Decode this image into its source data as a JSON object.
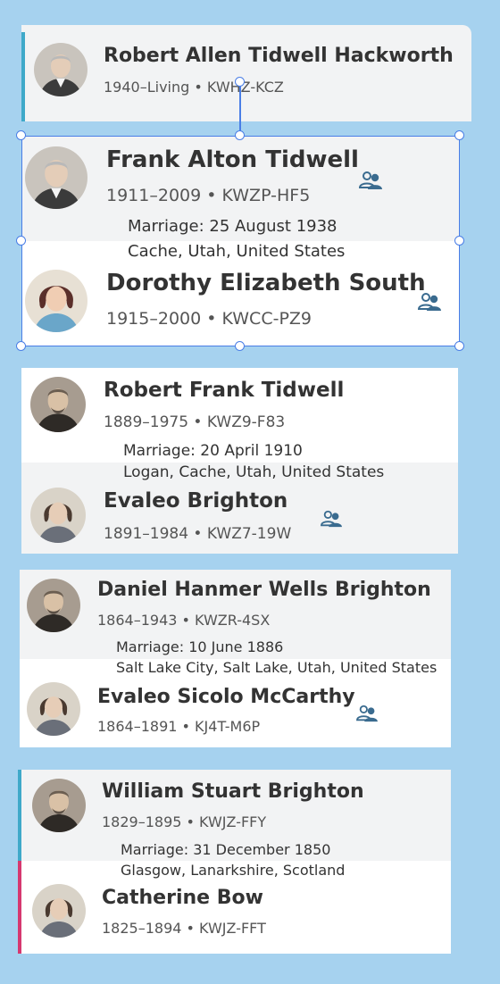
{
  "colors": {
    "background": "#a6d2ef",
    "selection": "#4a7ee6",
    "male_stripe": "#3fa9c9",
    "female_stripe": "#d6386f",
    "relationship_icon": "#3a6b8f"
  },
  "couples": [
    {
      "husband": {
        "name": "Robert Allen Tidwell Hackworth",
        "meta": "1940–Living • KWHZ-KCZ"
      }
    },
    {
      "husband": {
        "name": "Frank Alton Tidwell",
        "meta": "1911–2009 • KWZP-HF5"
      },
      "marriage": {
        "date": "Marriage: 25 August 1938",
        "place": "Cache, Utah, United States"
      },
      "wife": {
        "name": "Dorothy Elizabeth South",
        "meta": "1915–2000 • KWCC-PZ9"
      },
      "selected": true
    },
    {
      "husband": {
        "name": "Robert Frank Tidwell",
        "meta": "1889–1975 • KWZ9-F83"
      },
      "marriage": {
        "date": "Marriage: 20 April 1910",
        "place": "Logan, Cache, Utah, United States"
      },
      "wife": {
        "name": "Evaleo Brighton",
        "meta": "1891–1984 • KWZ7-19W"
      }
    },
    {
      "husband": {
        "name": "Daniel Hanmer Wells Brighton",
        "meta": "1864–1943 • KWZR-4SX"
      },
      "marriage": {
        "date": "Marriage: 10 June 1886",
        "place": "Salt Lake City, Salt Lake, Utah, United States"
      },
      "wife": {
        "name": "Evaleo Sicolo McCarthy",
        "meta": "1864–1891 • KJ4T-M6P"
      }
    },
    {
      "husband": {
        "name": "William Stuart Brighton",
        "meta": "1829–1895 • KWJZ-FFY"
      },
      "marriage": {
        "date": "Marriage: 31 December 1850",
        "place": "Glasgow, Lanarkshire, Scotland"
      },
      "wife": {
        "name": "Catherine Bow",
        "meta": "1825–1894 • KWJZ-FFT"
      }
    }
  ]
}
